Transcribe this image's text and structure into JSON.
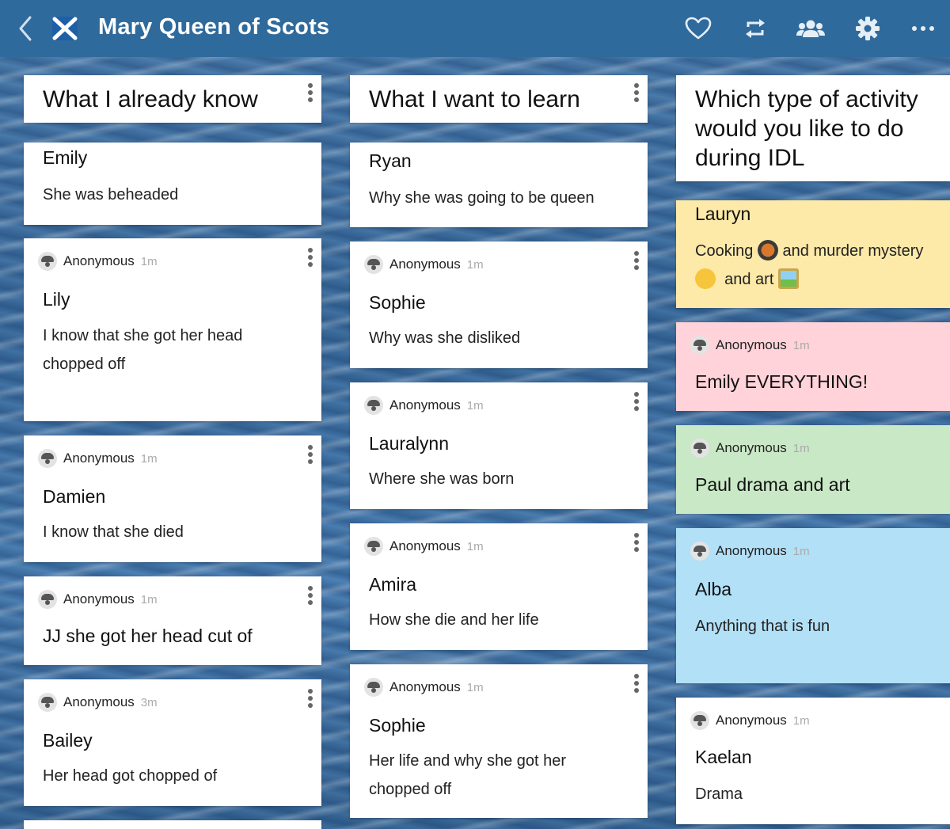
{
  "app": {
    "title": "Mary Queen of Scots",
    "colors": {
      "topbar": "#2f6a9c",
      "yellow": "#fde9a8",
      "pink": "#ffd3d9",
      "green": "#c9e8c6",
      "blue": "#b2e0f7"
    },
    "icons": [
      "back-chevron-icon",
      "scotland-flag-icon",
      "heart-icon",
      "remix-icon",
      "members-icon",
      "gear-icon",
      "more-horizontal-icon"
    ]
  },
  "columns": [
    {
      "title": "What I already know",
      "posts": [
        {
          "author": "",
          "time": "",
          "title": "Emily",
          "body": "She was beheaded"
        },
        {
          "author": "Anonymous",
          "time": "1m",
          "title": "Lily",
          "body": "I know that she got her head chopped off"
        },
        {
          "author": "Anonymous",
          "time": "1m",
          "title": "Damien",
          "body": "I know that she died"
        },
        {
          "author": "Anonymous",
          "time": "1m",
          "title": "JJ she got her head cut of",
          "body": ""
        },
        {
          "author": "Anonymous",
          "time": "3m",
          "title": "Bailey",
          "body": "Her head  got chopped of"
        }
      ]
    },
    {
      "title": "What I want to learn",
      "posts": [
        {
          "author": "",
          "time": "",
          "title": "Ryan",
          "body": "Why she was going to be queen"
        },
        {
          "author": "Anonymous",
          "time": "1m",
          "title": "Sophie",
          "body": "Why was she disliked"
        },
        {
          "author": "Anonymous",
          "time": "1m",
          "title": "Lauralynn",
          "body": "Where she was born"
        },
        {
          "author": "Anonymous",
          "time": "1m",
          "title": "Amira",
          "body": "How she die and her life"
        },
        {
          "author": "Anonymous",
          "time": "1m",
          "title": "Sophie",
          "body": "Her life and why she got her chopped off"
        }
      ]
    },
    {
      "title": "Which type of activity would you like to do during IDL",
      "posts": [
        {
          "author": "",
          "time": "",
          "title": "Lauryn",
          "body_parts": [
            "Cooking",
            "and murder mystery",
            "and art"
          ],
          "emojis": [
            "cooking-pan-emoji",
            "thinking-face-emoji",
            "framed-picture-emoji"
          ],
          "color": "yellow"
        },
        {
          "author": "Anonymous",
          "time": "1m",
          "title": "Emily EVERYTHING!",
          "body": "",
          "color": "pink"
        },
        {
          "author": "Anonymous",
          "time": "1m",
          "title": "Paul drama and art",
          "body": "",
          "color": "green"
        },
        {
          "author": "Anonymous",
          "time": "1m",
          "title": "Alba",
          "body": "Anything that is fun",
          "color": "blue"
        },
        {
          "author": "Anonymous",
          "time": "1m",
          "title": "Kaelan",
          "body": "Drama",
          "color": "white"
        }
      ]
    }
  ]
}
